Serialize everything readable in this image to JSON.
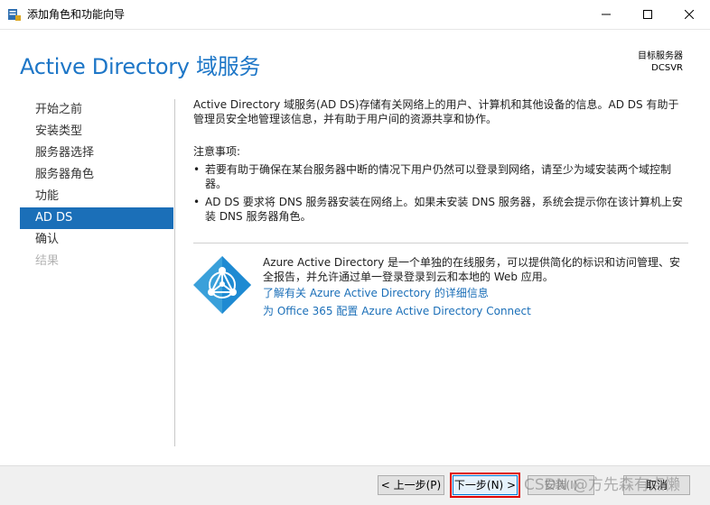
{
  "window": {
    "title": "添加角色和功能向导"
  },
  "header": {
    "page_title": "Active Directory 域服务",
    "target_label": "目标服务器",
    "target_name": "DCSVR"
  },
  "nav": {
    "items": [
      {
        "label": "开始之前",
        "state": "normal"
      },
      {
        "label": "安装类型",
        "state": "normal"
      },
      {
        "label": "服务器选择",
        "state": "normal"
      },
      {
        "label": "服务器角色",
        "state": "normal"
      },
      {
        "label": "功能",
        "state": "normal"
      },
      {
        "label": "AD DS",
        "state": "active"
      },
      {
        "label": "确认",
        "state": "normal"
      },
      {
        "label": "结果",
        "state": "disabled"
      }
    ]
  },
  "main": {
    "intro": "Active Directory 域服务(AD DS)存储有关网络上的用户、计算机和其他设备的信息。AD DS 有助于管理员安全地管理该信息，并有助于用户间的资源共享和协作。",
    "notes_title": "注意事项:",
    "notes": [
      "若要有助于确保在某台服务器中断的情况下用户仍然可以登录到网络，请至少为域安装两个域控制器。",
      "AD DS 要求将 DNS 服务器安装在网络上。如果未安装 DNS 服务器，系统会提示你在该计算机上安装 DNS 服务器角色。"
    ],
    "azure_desc": "Azure Active Directory 是一个单独的在线服务，可以提供简化的标识和访问管理、安全报告，并允许通过单一登录登录到云和本地的 Web 应用。",
    "link1": "了解有关 Azure Active Directory 的详细信息",
    "link2": "为 Office 365 配置 Azure Active Directory Connect"
  },
  "buttons": {
    "prev": "< 上一步(P)",
    "next": "下一步(N) >",
    "install": "安装(I)",
    "cancel": "取消"
  },
  "watermark": "CSDN @方先森有点懒",
  "colors": {
    "accent": "#1b6fb8",
    "title_blue": "#1d76c7",
    "highlight_red": "#e00000"
  }
}
